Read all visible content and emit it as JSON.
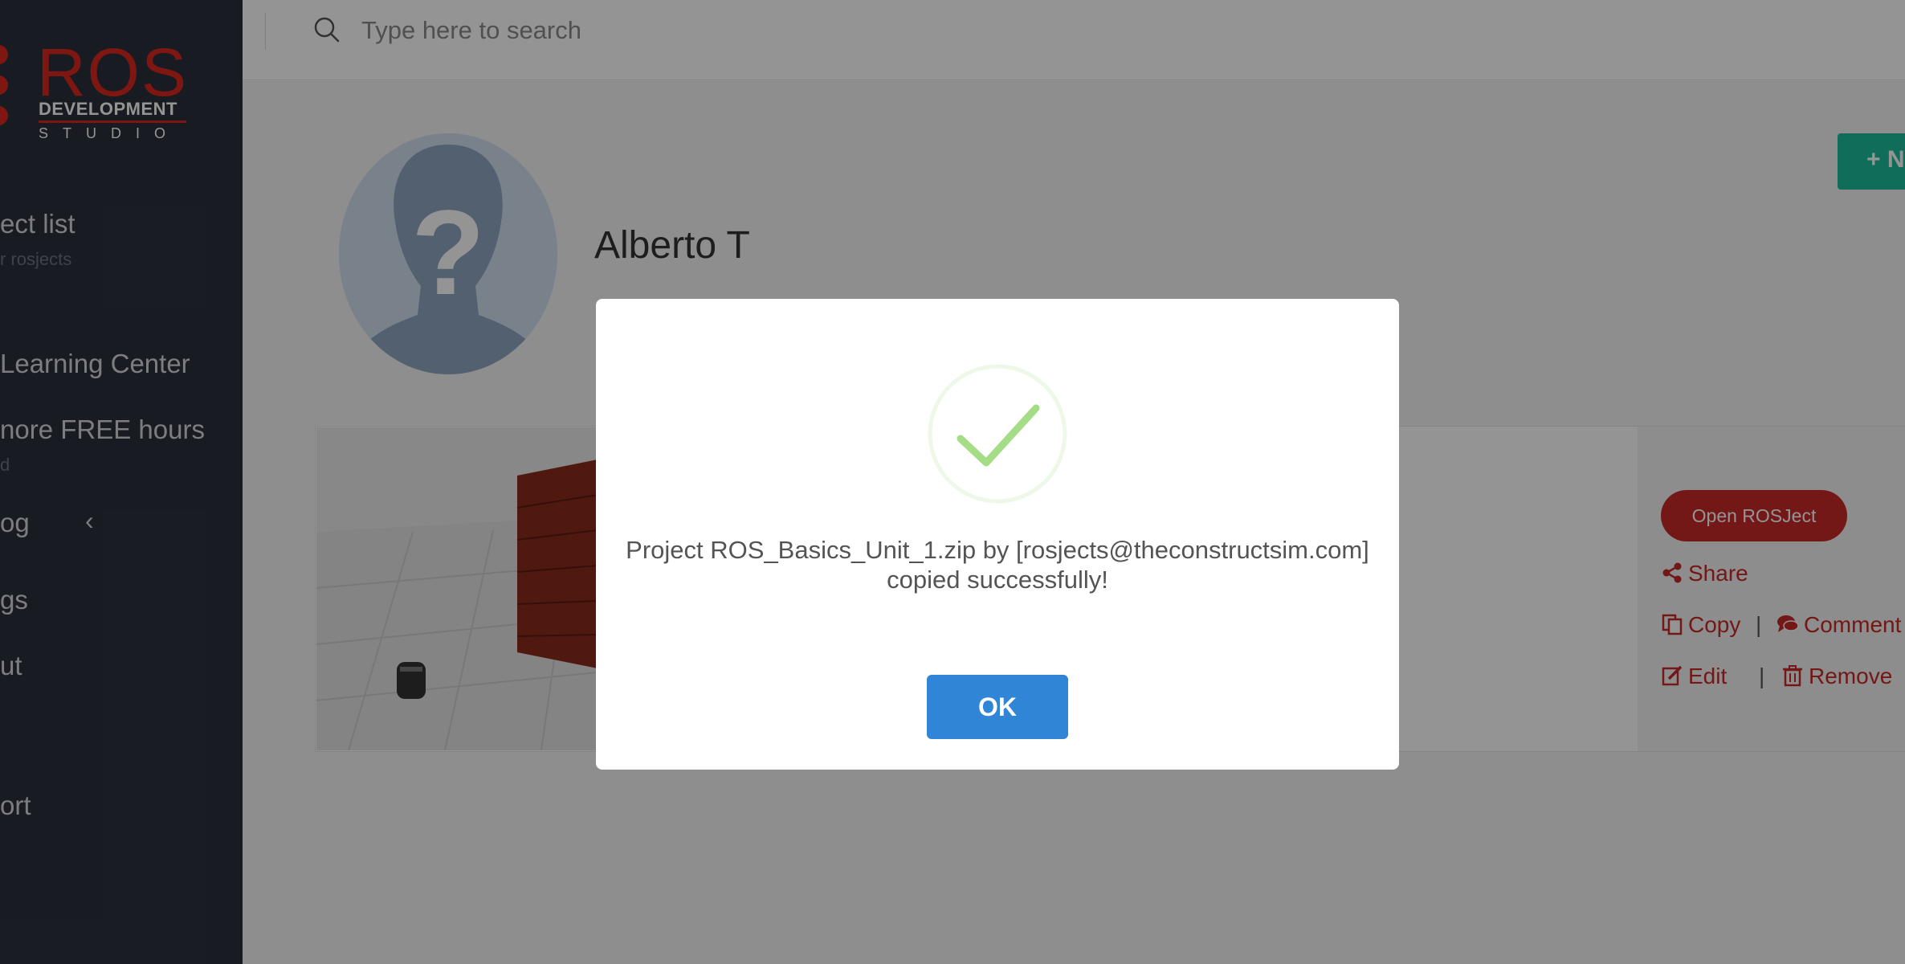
{
  "brand": {
    "logo_main": "ROS",
    "logo_sub": "DEVELOPMENT",
    "logo_studio": "STUDIO"
  },
  "sidebar": {
    "items": [
      {
        "label": "ect list",
        "sub": "r rosjects"
      },
      {
        "label": "Learning Center"
      },
      {
        "label": "nore FREE hours",
        "sub": "d"
      },
      {
        "label": "og"
      },
      {
        "label": "gs"
      },
      {
        "label": "ut"
      },
      {
        "label": "ort"
      }
    ],
    "chevron": "‹"
  },
  "search": {
    "placeholder": "Type here to search"
  },
  "new_button": {
    "label": "+ N"
  },
  "profile": {
    "name": "Alberto T"
  },
  "rosject_card": {
    "open_label": "Open ROSJect",
    "share_label": "Share",
    "copy_label": "Copy",
    "comment_label": "Comment",
    "edit_label": "Edit",
    "remove_label": "Remove",
    "separator": "|"
  },
  "modal": {
    "message": "Project ROS_Basics_Unit_1.zip by [rosjects@theconstructsim.com] copied successfully!",
    "ok_label": "OK"
  },
  "colors": {
    "sidebar_bg": "#2b303b",
    "brand_red": "#d9281e",
    "action_red": "#c62828",
    "new_button_teal": "#1abc9c",
    "ok_blue": "#3085d6",
    "success_green": "#a5dc86"
  }
}
